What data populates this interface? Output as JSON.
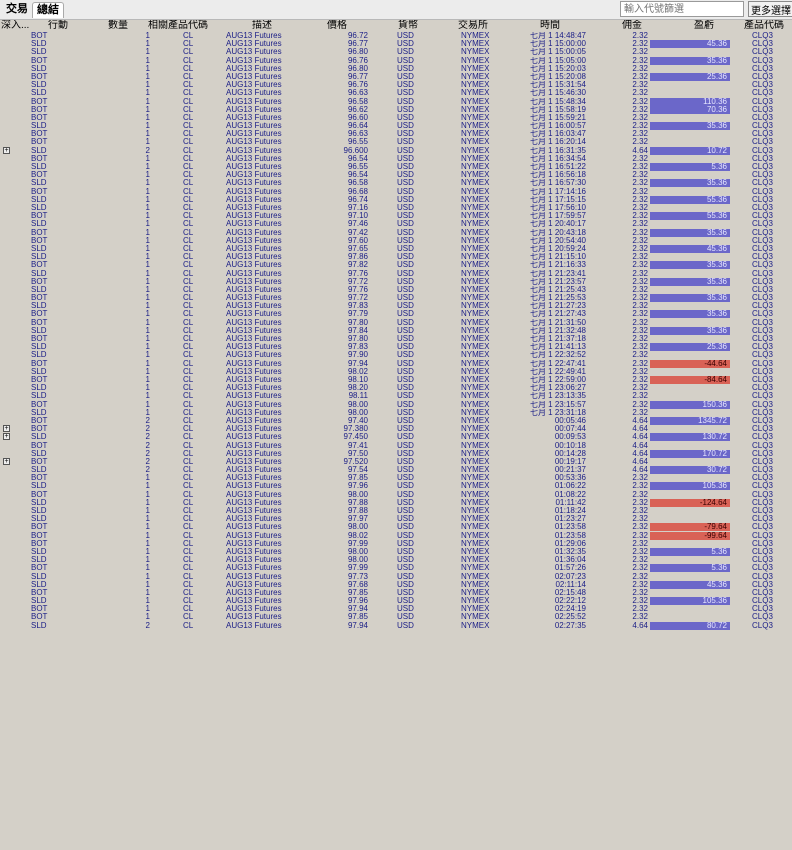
{
  "tabs": {
    "trades": "交易",
    "summary": "總結"
  },
  "search": {
    "placeholder": "輸入代號篩選"
  },
  "more_button": "更多選擇",
  "columns": {
    "drill": "深入...",
    "action": "行動",
    "quantity": "數量",
    "underlying": "相關產品代碼",
    "description": "描述",
    "price": "價格",
    "currency": "貨幣",
    "exchange": "交易所",
    "time": "時間",
    "commission": "佣金",
    "pnl": "盈虧",
    "symbol": "產品代碼"
  },
  "colors": {
    "profit": "#6b67c9",
    "loss": "#d96256"
  },
  "rows": [
    [
      "BOT",
      "1",
      "CL",
      "AUG13 Futures",
      "96.72",
      "USD",
      "NYMEX",
      "七月 1 14:48:47",
      "2.32",
      "",
      "CLQ3",
      0
    ],
    [
      "SLD",
      "1",
      "CL",
      "AUG13 Futures",
      "96.77",
      "USD",
      "NYMEX",
      "七月 1 15:00:00",
      "2.32",
      "45.36",
      "CLQ3",
      0
    ],
    [
      "SLD",
      "1",
      "CL",
      "AUG13 Futures",
      "96.80",
      "USD",
      "NYMEX",
      "七月 1 15:00:05",
      "2.32",
      "",
      "CLQ3",
      0
    ],
    [
      "BOT",
      "1",
      "CL",
      "AUG13 Futures",
      "96.76",
      "USD",
      "NYMEX",
      "七月 1 15:05:00",
      "2.32",
      "35.36",
      "CLQ3",
      0
    ],
    [
      "SLD",
      "1",
      "CL",
      "AUG13 Futures",
      "96.80",
      "USD",
      "NYMEX",
      "七月 1 15:20:03",
      "2.32",
      "",
      "CLQ3",
      0
    ],
    [
      "BOT",
      "1",
      "CL",
      "AUG13 Futures",
      "96.77",
      "USD",
      "NYMEX",
      "七月 1 15:20:08",
      "2.32",
      "25.36",
      "CLQ3",
      0
    ],
    [
      "SLD",
      "1",
      "CL",
      "AUG13 Futures",
      "96.76",
      "USD",
      "NYMEX",
      "七月 1 15:31:54",
      "2.32",
      "",
      "CLQ3",
      0
    ],
    [
      "SLD",
      "1",
      "CL",
      "AUG13 Futures",
      "96.63",
      "USD",
      "NYMEX",
      "七月 1 15:46:30",
      "2.32",
      "",
      "CLQ3",
      0
    ],
    [
      "BOT",
      "1",
      "CL",
      "AUG13 Futures",
      "96.58",
      "USD",
      "NYMEX",
      "七月 1 15:48:34",
      "2.32",
      "110.36",
      "CLQ3",
      0
    ],
    [
      "BOT",
      "1",
      "CL",
      "AUG13 Futures",
      "96.62",
      "USD",
      "NYMEX",
      "七月 1 15:58:19",
      "2.32",
      "70.36",
      "CLQ3",
      0
    ],
    [
      "BOT",
      "1",
      "CL",
      "AUG13 Futures",
      "96.60",
      "USD",
      "NYMEX",
      "七月 1 15:59:21",
      "2.32",
      "",
      "CLQ3",
      0
    ],
    [
      "SLD",
      "1",
      "CL",
      "AUG13 Futures",
      "96.64",
      "USD",
      "NYMEX",
      "七月 1 16:00:57",
      "2.32",
      "35.36",
      "CLQ3",
      0
    ],
    [
      "BOT",
      "1",
      "CL",
      "AUG13 Futures",
      "96.63",
      "USD",
      "NYMEX",
      "七月 1 16:03:47",
      "2.32",
      "",
      "CLQ3",
      0
    ],
    [
      "BOT",
      "1",
      "CL",
      "AUG13 Futures",
      "96.55",
      "USD",
      "NYMEX",
      "七月 1 16:20:14",
      "2.32",
      "",
      "CLQ3",
      0
    ],
    [
      "SLD",
      "2",
      "CL",
      "AUG13 Futures",
      "96.600",
      "USD",
      "NYMEX",
      "七月 1 16:31:35",
      "4.64",
      "10.72",
      "CLQ3",
      1
    ],
    [
      "BOT",
      "1",
      "CL",
      "AUG13 Futures",
      "96.54",
      "USD",
      "NYMEX",
      "七月 1 16:34:54",
      "2.32",
      "",
      "CLQ3",
      0
    ],
    [
      "SLD",
      "1",
      "CL",
      "AUG13 Futures",
      "96.55",
      "USD",
      "NYMEX",
      "七月 1 16:51:22",
      "2.32",
      "5.36",
      "CLQ3",
      0
    ],
    [
      "BOT",
      "1",
      "CL",
      "AUG13 Futures",
      "96.54",
      "USD",
      "NYMEX",
      "七月 1 16:56:18",
      "2.32",
      "",
      "CLQ3",
      0
    ],
    [
      "SLD",
      "1",
      "CL",
      "AUG13 Futures",
      "96.58",
      "USD",
      "NYMEX",
      "七月 1 16:57:30",
      "2.32",
      "35.36",
      "CLQ3",
      0
    ],
    [
      "BOT",
      "1",
      "CL",
      "AUG13 Futures",
      "96.68",
      "USD",
      "NYMEX",
      "七月 1 17:14:16",
      "2.32",
      "",
      "CLQ3",
      0
    ],
    [
      "SLD",
      "1",
      "CL",
      "AUG13 Futures",
      "96.74",
      "USD",
      "NYMEX",
      "七月 1 17:15:15",
      "2.32",
      "55.36",
      "CLQ3",
      0
    ],
    [
      "SLD",
      "1",
      "CL",
      "AUG13 Futures",
      "97.16",
      "USD",
      "NYMEX",
      "七月 1 17:56:10",
      "2.32",
      "",
      "CLQ3",
      0
    ],
    [
      "BOT",
      "1",
      "CL",
      "AUG13 Futures",
      "97.10",
      "USD",
      "NYMEX",
      "七月 1 17:59:57",
      "2.32",
      "55.36",
      "CLQ3",
      0
    ],
    [
      "SLD",
      "1",
      "CL",
      "AUG13 Futures",
      "97.46",
      "USD",
      "NYMEX",
      "七月 1 20:40:17",
      "2.32",
      "",
      "CLQ3",
      0
    ],
    [
      "BOT",
      "1",
      "CL",
      "AUG13 Futures",
      "97.42",
      "USD",
      "NYMEX",
      "七月 1 20:43:18",
      "2.32",
      "35.36",
      "CLQ3",
      0
    ],
    [
      "BOT",
      "1",
      "CL",
      "AUG13 Futures",
      "97.60",
      "USD",
      "NYMEX",
      "七月 1 20:54:40",
      "2.32",
      "",
      "CLQ3",
      0
    ],
    [
      "SLD",
      "1",
      "CL",
      "AUG13 Futures",
      "97.65",
      "USD",
      "NYMEX",
      "七月 1 20:59:24",
      "2.32",
      "45.36",
      "CLQ3",
      0
    ],
    [
      "SLD",
      "1",
      "CL",
      "AUG13 Futures",
      "97.86",
      "USD",
      "NYMEX",
      "七月 1 21:15:10",
      "2.32",
      "",
      "CLQ3",
      0
    ],
    [
      "BOT",
      "1",
      "CL",
      "AUG13 Futures",
      "97.82",
      "USD",
      "NYMEX",
      "七月 1 21:16:33",
      "2.32",
      "35.36",
      "CLQ3",
      0
    ],
    [
      "SLD",
      "1",
      "CL",
      "AUG13 Futures",
      "97.76",
      "USD",
      "NYMEX",
      "七月 1 21:23:41",
      "2.32",
      "",
      "CLQ3",
      0
    ],
    [
      "BOT",
      "1",
      "CL",
      "AUG13 Futures",
      "97.72",
      "USD",
      "NYMEX",
      "七月 1 21:23:57",
      "2.32",
      "35.36",
      "CLQ3",
      0
    ],
    [
      "SLD",
      "1",
      "CL",
      "AUG13 Futures",
      "97.76",
      "USD",
      "NYMEX",
      "七月 1 21:25:43",
      "2.32",
      "",
      "CLQ3",
      0
    ],
    [
      "BOT",
      "1",
      "CL",
      "AUG13 Futures",
      "97.72",
      "USD",
      "NYMEX",
      "七月 1 21:25:53",
      "2.32",
      "35.36",
      "CLQ3",
      0
    ],
    [
      "SLD",
      "1",
      "CL",
      "AUG13 Futures",
      "97.83",
      "USD",
      "NYMEX",
      "七月 1 21:27:23",
      "2.32",
      "",
      "CLQ3",
      0
    ],
    [
      "BOT",
      "1",
      "CL",
      "AUG13 Futures",
      "97.79",
      "USD",
      "NYMEX",
      "七月 1 21:27:43",
      "2.32",
      "35.36",
      "CLQ3",
      0
    ],
    [
      "BOT",
      "1",
      "CL",
      "AUG13 Futures",
      "97.80",
      "USD",
      "NYMEX",
      "七月 1 21:31:50",
      "2.32",
      "",
      "CLQ3",
      0
    ],
    [
      "SLD",
      "1",
      "CL",
      "AUG13 Futures",
      "97.84",
      "USD",
      "NYMEX",
      "七月 1 21:32:48",
      "2.32",
      "35.36",
      "CLQ3",
      0
    ],
    [
      "BOT",
      "1",
      "CL",
      "AUG13 Futures",
      "97.80",
      "USD",
      "NYMEX",
      "七月 1 21:37:18",
      "2.32",
      "",
      "CLQ3",
      0
    ],
    [
      "SLD",
      "1",
      "CL",
      "AUG13 Futures",
      "97.83",
      "USD",
      "NYMEX",
      "七月 1 21:41:13",
      "2.32",
      "25.36",
      "CLQ3",
      0
    ],
    [
      "SLD",
      "1",
      "CL",
      "AUG13 Futures",
      "97.90",
      "USD",
      "NYMEX",
      "七月 1 22:32:52",
      "2.32",
      "",
      "CLQ3",
      0
    ],
    [
      "BOT",
      "1",
      "CL",
      "AUG13 Futures",
      "97.94",
      "USD",
      "NYMEX",
      "七月 1 22:47:41",
      "2.32",
      "-44.64",
      "CLQ3",
      0
    ],
    [
      "SLD",
      "1",
      "CL",
      "AUG13 Futures",
      "98.02",
      "USD",
      "NYMEX",
      "七月 1 22:49:41",
      "2.32",
      "",
      "CLQ3",
      0
    ],
    [
      "BOT",
      "1",
      "CL",
      "AUG13 Futures",
      "98.10",
      "USD",
      "NYMEX",
      "七月 1 22:59:00",
      "2.32",
      "-84.64",
      "CLQ3",
      0
    ],
    [
      "SLD",
      "1",
      "CL",
      "AUG13 Futures",
      "98.20",
      "USD",
      "NYMEX",
      "七月 1 23:06:27",
      "2.32",
      "",
      "CLQ3",
      0
    ],
    [
      "SLD",
      "1",
      "CL",
      "AUG13 Futures",
      "98.11",
      "USD",
      "NYMEX",
      "七月 1 23:13:35",
      "2.32",
      "",
      "CLQ3",
      0
    ],
    [
      "BOT",
      "1",
      "CL",
      "AUG13 Futures",
      "98.00",
      "USD",
      "NYMEX",
      "七月 1 23:15:57",
      "2.32",
      "150.36",
      "CLQ3",
      0
    ],
    [
      "SLD",
      "1",
      "CL",
      "AUG13 Futures",
      "98.00",
      "USD",
      "NYMEX",
      "七月 1 23:31:18",
      "2.32",
      "",
      "CLQ3",
      0
    ],
    [
      "BOT",
      "2",
      "CL",
      "AUG13 Futures",
      "97.40",
      "USD",
      "NYMEX",
      "00:05:46",
      "4.64",
      "1345.72",
      "CLQ3",
      0
    ],
    [
      "BOT",
      "2",
      "CL",
      "AUG13 Futures",
      "97.380",
      "USD",
      "NYMEX",
      "00:07:44",
      "4.64",
      "",
      "CLQ3",
      1
    ],
    [
      "SLD",
      "2",
      "CL",
      "AUG13 Futures",
      "97.450",
      "USD",
      "NYMEX",
      "00:09:53",
      "4.64",
      "130.72",
      "CLQ3",
      1
    ],
    [
      "BOT",
      "2",
      "CL",
      "AUG13 Futures",
      "97.41",
      "USD",
      "NYMEX",
      "00:10:18",
      "4.64",
      "",
      "CLQ3",
      0
    ],
    [
      "SLD",
      "2",
      "CL",
      "AUG13 Futures",
      "97.50",
      "USD",
      "NYMEX",
      "00:14:28",
      "4.64",
      "170.72",
      "CLQ3",
      0
    ],
    [
      "BOT",
      "2",
      "CL",
      "AUG13 Futures",
      "97.520",
      "USD",
      "NYMEX",
      "00:19:17",
      "4.64",
      "",
      "CLQ3",
      1
    ],
    [
      "SLD",
      "2",
      "CL",
      "AUG13 Futures",
      "97.54",
      "USD",
      "NYMEX",
      "00:21:37",
      "4.64",
      "30.72",
      "CLQ3",
      0
    ],
    [
      "BOT",
      "1",
      "CL",
      "AUG13 Futures",
      "97.85",
      "USD",
      "NYMEX",
      "00:53:36",
      "2.32",
      "",
      "CLQ3",
      0
    ],
    [
      "SLD",
      "1",
      "CL",
      "AUG13 Futures",
      "97.96",
      "USD",
      "NYMEX",
      "01:06:22",
      "2.32",
      "105.36",
      "CLQ3",
      0
    ],
    [
      "BOT",
      "1",
      "CL",
      "AUG13 Futures",
      "98.00",
      "USD",
      "NYMEX",
      "01:08:22",
      "2.32",
      "",
      "CLQ3",
      0
    ],
    [
      "SLD",
      "1",
      "CL",
      "AUG13 Futures",
      "97.88",
      "USD",
      "NYMEX",
      "01:11:42",
      "2.32",
      "-124.64",
      "CLQ3",
      0
    ],
    [
      "SLD",
      "1",
      "CL",
      "AUG13 Futures",
      "97.88",
      "USD",
      "NYMEX",
      "01:18:24",
      "2.32",
      "",
      "CLQ3",
      0
    ],
    [
      "SLD",
      "1",
      "CL",
      "AUG13 Futures",
      "97.97",
      "USD",
      "NYMEX",
      "01:23:27",
      "2.32",
      "",
      "CLQ3",
      0
    ],
    [
      "BOT",
      "1",
      "CL",
      "AUG13 Futures",
      "98.00",
      "USD",
      "NYMEX",
      "01:23:58",
      "2.32",
      "-79.64",
      "CLQ3",
      0
    ],
    [
      "BOT",
      "1",
      "CL",
      "AUG13 Futures",
      "98.02",
      "USD",
      "NYMEX",
      "01:23:58",
      "2.32",
      "-99.64",
      "CLQ3",
      0
    ],
    [
      "BOT",
      "1",
      "CL",
      "AUG13 Futures",
      "97.99",
      "USD",
      "NYMEX",
      "01:29:06",
      "2.32",
      "",
      "CLQ3",
      0
    ],
    [
      "SLD",
      "1",
      "CL",
      "AUG13 Futures",
      "98.00",
      "USD",
      "NYMEX",
      "01:32:35",
      "2.32",
      "5.36",
      "CLQ3",
      0
    ],
    [
      "SLD",
      "1",
      "CL",
      "AUG13 Futures",
      "98.00",
      "USD",
      "NYMEX",
      "01:36:04",
      "2.32",
      "",
      "CLQ3",
      0
    ],
    [
      "BOT",
      "1",
      "CL",
      "AUG13 Futures",
      "97.99",
      "USD",
      "NYMEX",
      "01:57:26",
      "2.32",
      "5.36",
      "CLQ3",
      0
    ],
    [
      "SLD",
      "1",
      "CL",
      "AUG13 Futures",
      "97.73",
      "USD",
      "NYMEX",
      "02:07:23",
      "2.32",
      "",
      "CLQ3",
      0
    ],
    [
      "SLD",
      "1",
      "CL",
      "AUG13 Futures",
      "97.68",
      "USD",
      "NYMEX",
      "02:11:14",
      "2.32",
      "45.36",
      "CLQ3",
      0
    ],
    [
      "BOT",
      "1",
      "CL",
      "AUG13 Futures",
      "97.85",
      "USD",
      "NYMEX",
      "02:15:48",
      "2.32",
      "",
      "CLQ3",
      0
    ],
    [
      "SLD",
      "1",
      "CL",
      "AUG13 Futures",
      "97.96",
      "USD",
      "NYMEX",
      "02:22:12",
      "2.32",
      "105.36",
      "CLQ3",
      0
    ],
    [
      "BOT",
      "1",
      "CL",
      "AUG13 Futures",
      "97.94",
      "USD",
      "NYMEX",
      "02:24:19",
      "2.32",
      "",
      "CLQ3",
      0
    ],
    [
      "BOT",
      "1",
      "CL",
      "AUG13 Futures",
      "97.85",
      "USD",
      "NYMEX",
      "02:25:52",
      "2.32",
      "",
      "CLQ3",
      0
    ],
    [
      "SLD",
      "2",
      "CL",
      "AUG13 Futures",
      "97.94",
      "USD",
      "NYMEX",
      "02:27:35",
      "4.64",
      "80.72",
      "CLQ3",
      0
    ]
  ]
}
